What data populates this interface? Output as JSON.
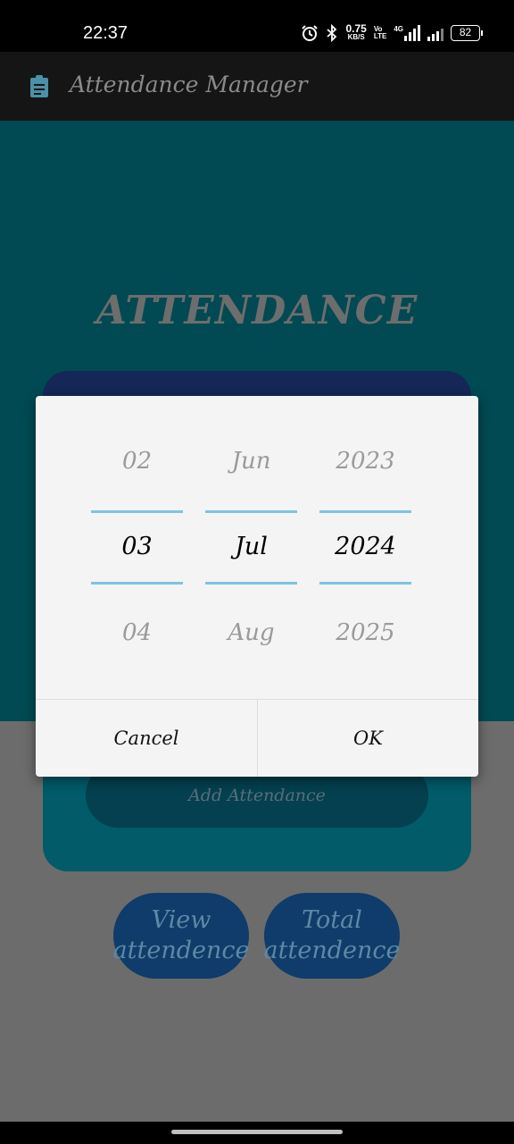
{
  "status_bar": {
    "time": "22:37",
    "net_speed_value": "0.75",
    "net_speed_unit": "KB/S",
    "volte_top": "Vo",
    "volte_bottom": "LTE",
    "network_type": "4G",
    "battery": "82"
  },
  "app_bar": {
    "title": "Attendance Manager",
    "icon": "clipboard-icon"
  },
  "main": {
    "heading": "ATTENDANCE",
    "add_button": "Add Attendance",
    "view_button_line1": "View",
    "view_button_line2": "attendence",
    "total_button_line1": "Total",
    "total_button_line2": "attendence"
  },
  "date_picker": {
    "day": {
      "prev": "02",
      "selected": "03",
      "next": "04"
    },
    "month": {
      "prev": "Jun",
      "selected": "Jul",
      "next": "Aug"
    },
    "year": {
      "prev": "2023",
      "selected": "2024",
      "next": "2025"
    },
    "cancel_label": "Cancel",
    "ok_label": "OK"
  },
  "colors": {
    "teal_bg": "#014a53",
    "dialog_bg": "#f4f4f4",
    "selection_line": "#7cc4e2"
  }
}
